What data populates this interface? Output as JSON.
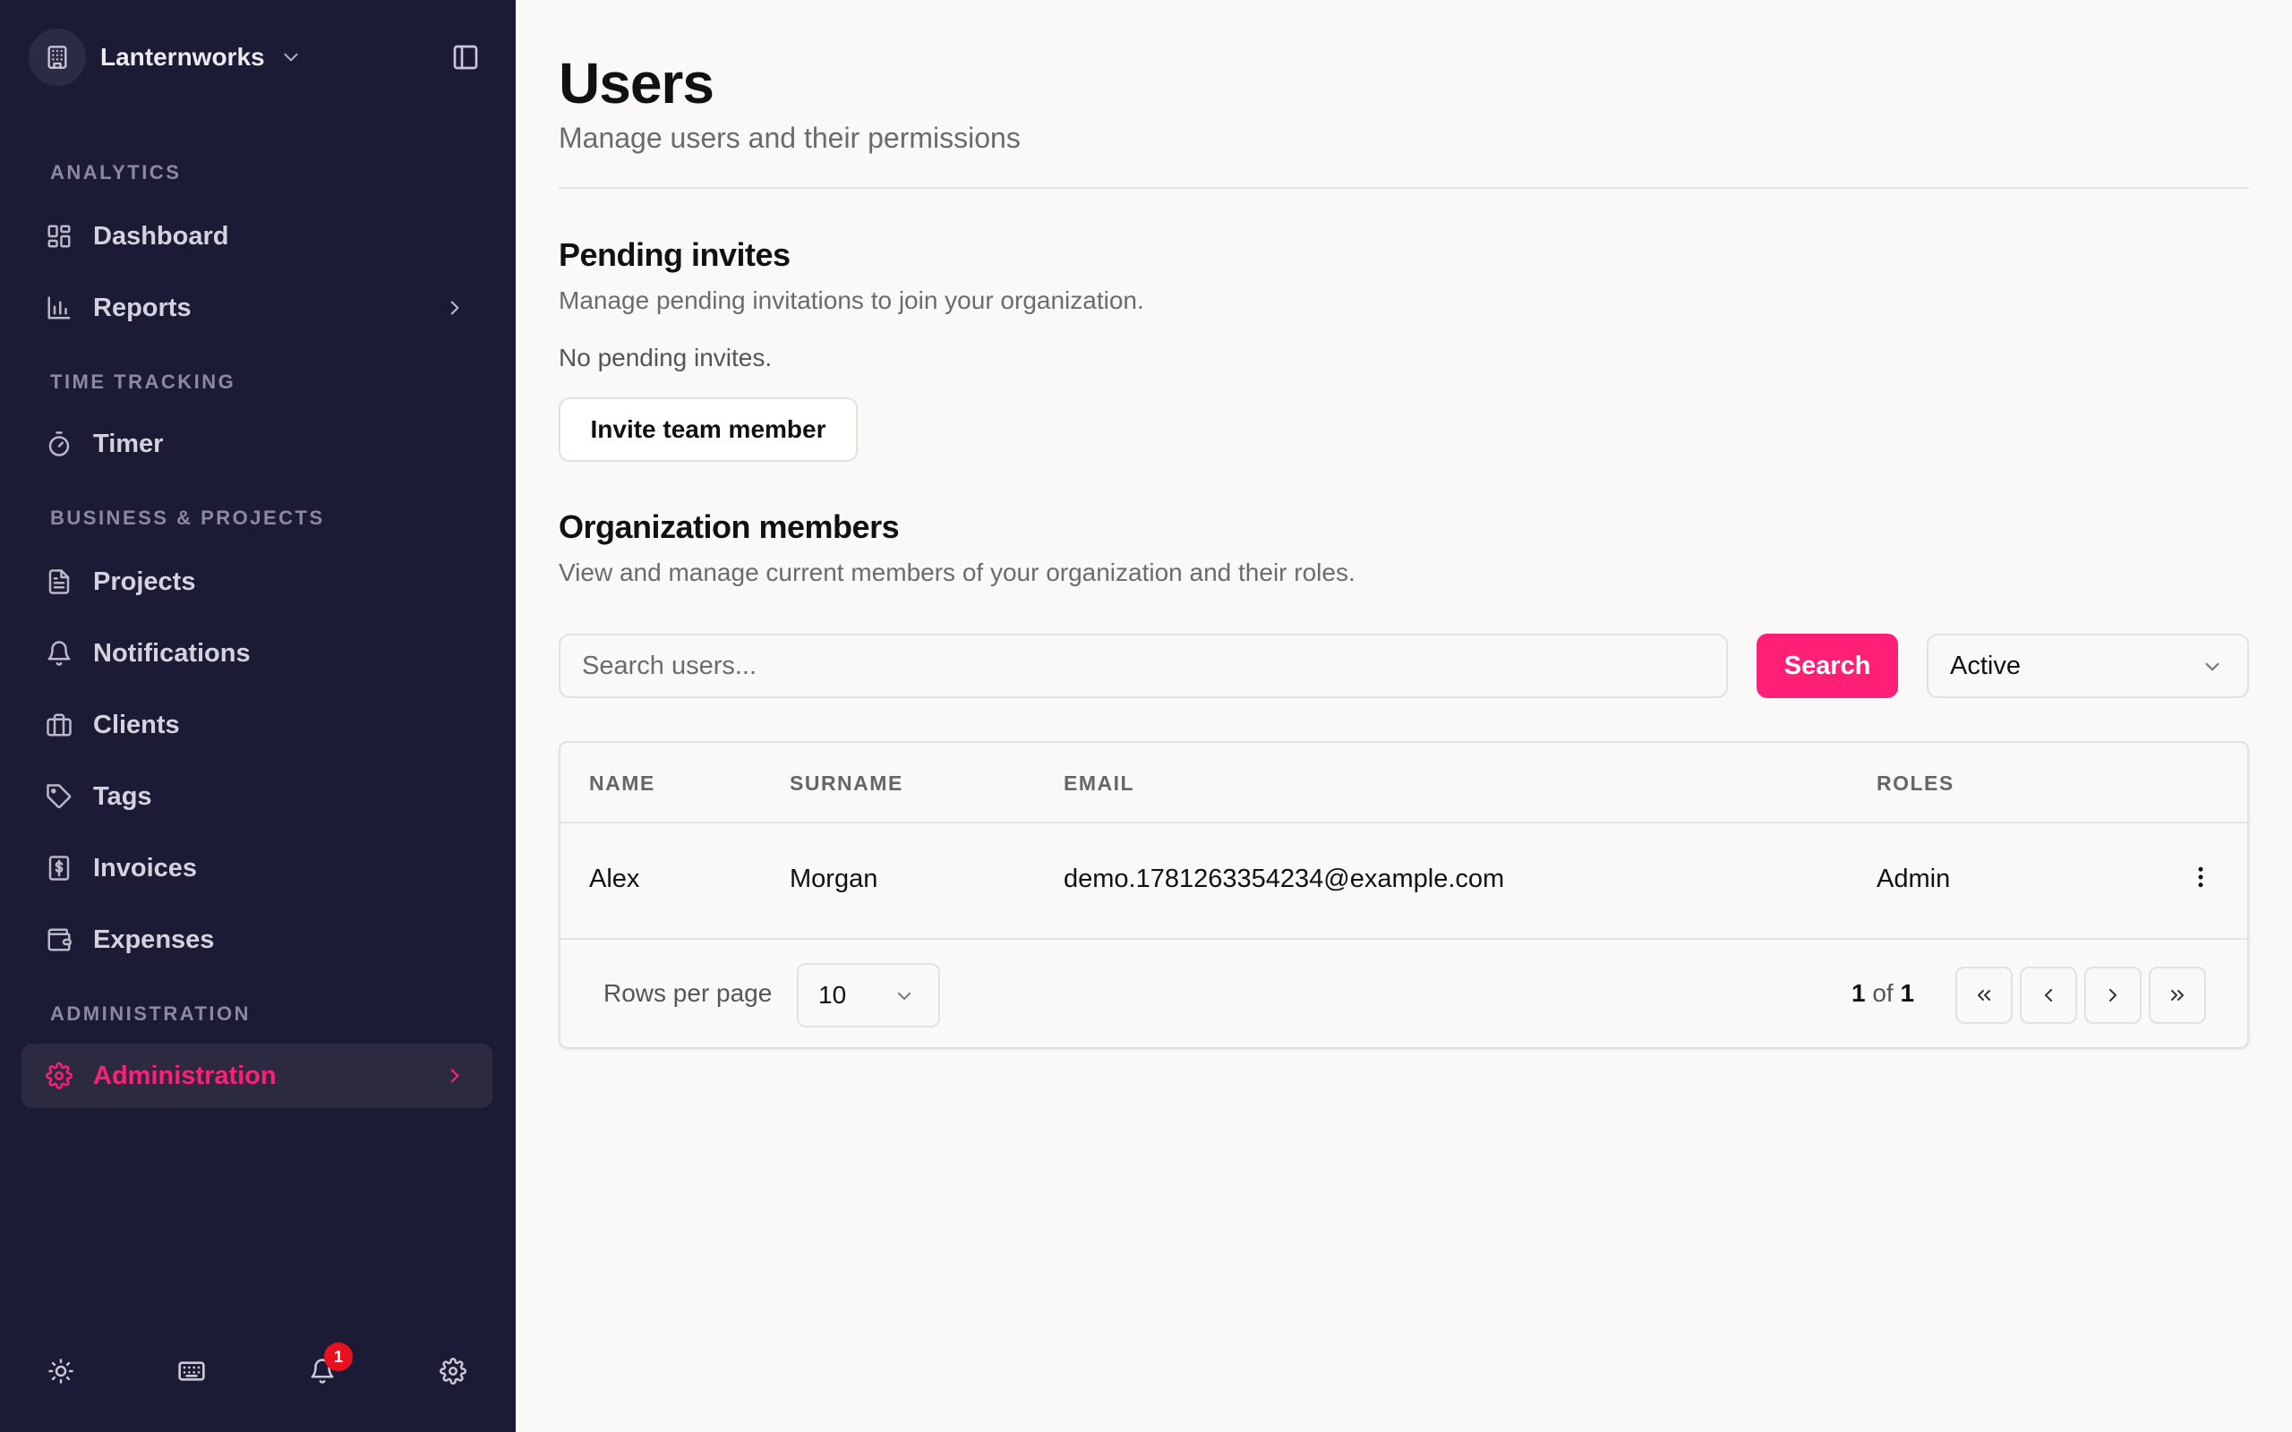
{
  "org": {
    "name": "Lanternworks"
  },
  "sidebar": {
    "sections": [
      "ANALYTICS",
      "TIME TRACKING",
      "BUSINESS & PROJECTS",
      "ADMINISTRATION"
    ],
    "items": [
      {
        "label": "Dashboard",
        "icon": "dashboard-icon"
      },
      {
        "label": "Reports",
        "icon": "bar-chart-icon"
      },
      {
        "label": "Timer",
        "icon": "stopwatch-icon"
      },
      {
        "label": "Projects",
        "icon": "document-icon"
      },
      {
        "label": "Notifications",
        "icon": "bell-icon"
      },
      {
        "label": "Clients",
        "icon": "briefcase-icon"
      },
      {
        "label": "Tags",
        "icon": "tag-icon"
      },
      {
        "label": "Invoices",
        "icon": "invoice-icon"
      },
      {
        "label": "Expenses",
        "icon": "wallet-icon"
      },
      {
        "label": "Administration",
        "icon": "gear-icon"
      }
    ],
    "active_item": "Administration",
    "notification_count": "1"
  },
  "page": {
    "title": "Users",
    "subtitle": "Manage users and their permissions"
  },
  "pending": {
    "title": "Pending invites",
    "description": "Manage pending invitations to join your organization.",
    "empty_text": "No pending invites.",
    "invite_button": "Invite team member"
  },
  "members": {
    "title": "Organization members",
    "description": "View and manage current members of your organization and their roles.",
    "search_placeholder": "Search users...",
    "search_button": "Search",
    "status_filter": "Active",
    "columns": [
      "NAME",
      "SURNAME",
      "EMAIL",
      "ROLES"
    ],
    "rows": [
      {
        "name": "Alex",
        "surname": "Morgan",
        "email": "demo.1781263354234@example.com",
        "role": "Admin"
      }
    ],
    "rows_per_page_label": "Rows per page",
    "rows_per_page": "10",
    "page_current": "1",
    "page_of": "of",
    "page_total": "1"
  },
  "colors": {
    "sidebar_bg": "#1c1b35",
    "accent": "#ff1f75",
    "badge": "#e8101f",
    "page_bg": "#faf9f7"
  }
}
